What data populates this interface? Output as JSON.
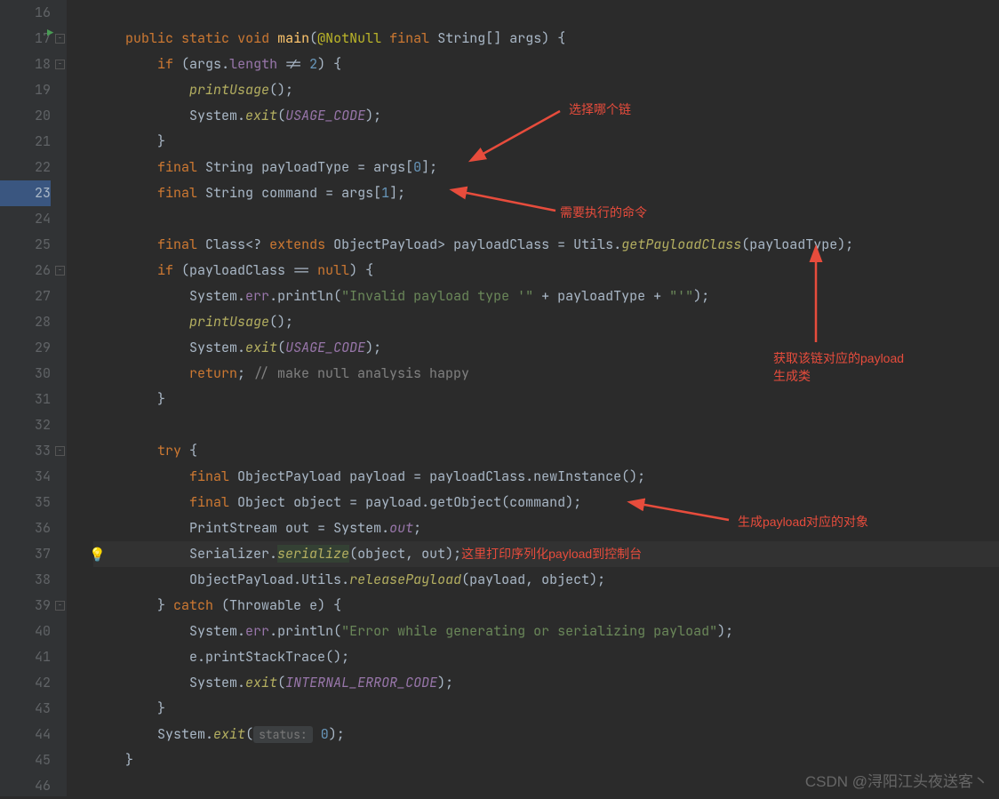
{
  "gutter": {
    "lines": [
      "16",
      "17",
      "18",
      "19",
      "20",
      "21",
      "22",
      "23",
      "24",
      "25",
      "26",
      "27",
      "28",
      "29",
      "30",
      "31",
      "32",
      "33",
      "34",
      "35",
      "36",
      "37",
      "38",
      "39",
      "40",
      "41",
      "42",
      "43",
      "44",
      "45",
      "46"
    ],
    "breakpoints": [
      23
    ]
  },
  "icons": {
    "run": "▶",
    "bulb": "💡"
  },
  "code": {
    "l17": {
      "public": "public",
      "static": "static",
      "void": "void",
      "main": "main",
      "nn": "@NotNull",
      "final": "final",
      "string": "String",
      "args": "args"
    },
    "l18": {
      "if": "if",
      "args": "args",
      "len": "length",
      "neq": " != ",
      "two": "2"
    },
    "l19": {
      "pu": "printUsage"
    },
    "l20": {
      "sys": "System",
      "exit": "exit",
      "uc": "USAGE_CODE"
    },
    "l22": {
      "final": "final",
      "string": "String",
      "id": "payloadType",
      "args": "args",
      "idx": "0"
    },
    "l23": {
      "final": "final",
      "string": "String",
      "id": "command",
      "args": "args",
      "idx": "1"
    },
    "l25": {
      "final": "final",
      "cls": "Class",
      "ext": "extends",
      "op": "ObjectPayload",
      "id": "payloadClass",
      "utils": "Utils",
      "gp": "getPayloadClass",
      "arg": "payloadType"
    },
    "l26": {
      "if": "if",
      "id": "payloadClass",
      "null": "null"
    },
    "l27": {
      "sys": "System",
      "err": "err",
      "println": "println",
      "s1": "\"Invalid payload type '\"",
      "pt": "payloadType",
      "s2": "\"'\""
    },
    "l28": {
      "pu": "printUsage"
    },
    "l29": {
      "sys": "System",
      "exit": "exit",
      "uc": "USAGE_CODE"
    },
    "l30": {
      "ret": "return",
      "cmt": "// make null analysis happy"
    },
    "l33": {
      "try": "try"
    },
    "l34": {
      "final": "final",
      "op": "ObjectPayload",
      "id": "payload",
      "pc": "payloadClass",
      "ni": "newInstance"
    },
    "l35": {
      "final": "final",
      "obj": "Object",
      "id": "object",
      "p": "payload",
      "go": "getObject",
      "cmd": "command"
    },
    "l36": {
      "ps": "PrintStream",
      "out": "out",
      "sys": "System",
      "sout": "out"
    },
    "l37": {
      "ser": "Serializer",
      "m": "serialize",
      "a1": "object",
      "a2": "out"
    },
    "l38": {
      "op": "ObjectPayload",
      "u": "Utils",
      "rp": "releasePayload",
      "a1": "payload",
      "a2": "object"
    },
    "l39": {
      "catch": "catch",
      "th": "Throwable",
      "e": "e"
    },
    "l40": {
      "sys": "System",
      "err": "err",
      "println": "println",
      "s": "\"Error while generating or serializing payload\""
    },
    "l41": {
      "e": "e",
      "pst": "printStackTrace"
    },
    "l42": {
      "sys": "System",
      "exit": "exit",
      "ie": "INTERNAL_ERROR_CODE"
    },
    "l44": {
      "sys": "System",
      "exit": "exit",
      "hint": "status:",
      "zero": "0"
    }
  },
  "annotations": {
    "a1": "选择哪个链",
    "a2": "需要执行的命令",
    "a3a": "获取该链对应的payload",
    "a3b": "生成类",
    "a4": "生成payload对应的对象",
    "a5": "这里打印序列化payload到控制台"
  },
  "watermark": "CSDN @浔阳江头夜送客丶"
}
